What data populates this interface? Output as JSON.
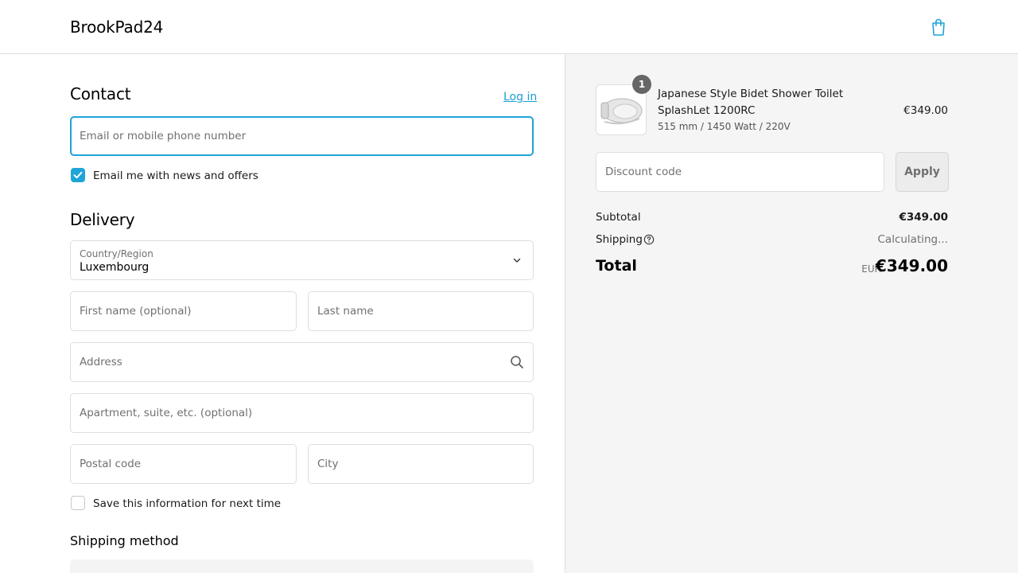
{
  "header": {
    "store_name": "BrookPad24",
    "cart_icon": "shopping-bag-icon"
  },
  "contact": {
    "heading": "Contact",
    "login_link": "Log in",
    "email_placeholder": "Email or mobile phone number",
    "news_checkbox_label": "Email me with news and offers",
    "news_checked": true
  },
  "delivery": {
    "heading": "Delivery",
    "country_label": "Country/Region",
    "country_value": "Luxembourg",
    "first_name_placeholder": "First name (optional)",
    "last_name_placeholder": "Last name",
    "address_placeholder": "Address",
    "apartment_placeholder": "Apartment, suite, etc. (optional)",
    "postal_placeholder": "Postal code",
    "city_placeholder": "City",
    "save_info_label": "Save this information for next time",
    "save_info_checked": false
  },
  "shipping_method": {
    "heading": "Shipping method"
  },
  "order_summary": {
    "item": {
      "quantity": "1",
      "title": "Japanese Style Bidet Shower Toilet SplashLet 1200RC",
      "variant": "515 mm / 1450 Watt / 220V",
      "price": "€349.00"
    },
    "discount_placeholder": "Discount code",
    "apply_label": "Apply",
    "subtotal_label": "Subtotal",
    "subtotal_value": "€349.00",
    "shipping_label": "Shipping",
    "shipping_value": "Calculating...",
    "total_label": "Total",
    "currency": "EUR",
    "total_value": "€349.00"
  },
  "colors": {
    "accent": "#1fa4d8",
    "summary_bg": "#f5f5f5",
    "border": "#dedede"
  }
}
